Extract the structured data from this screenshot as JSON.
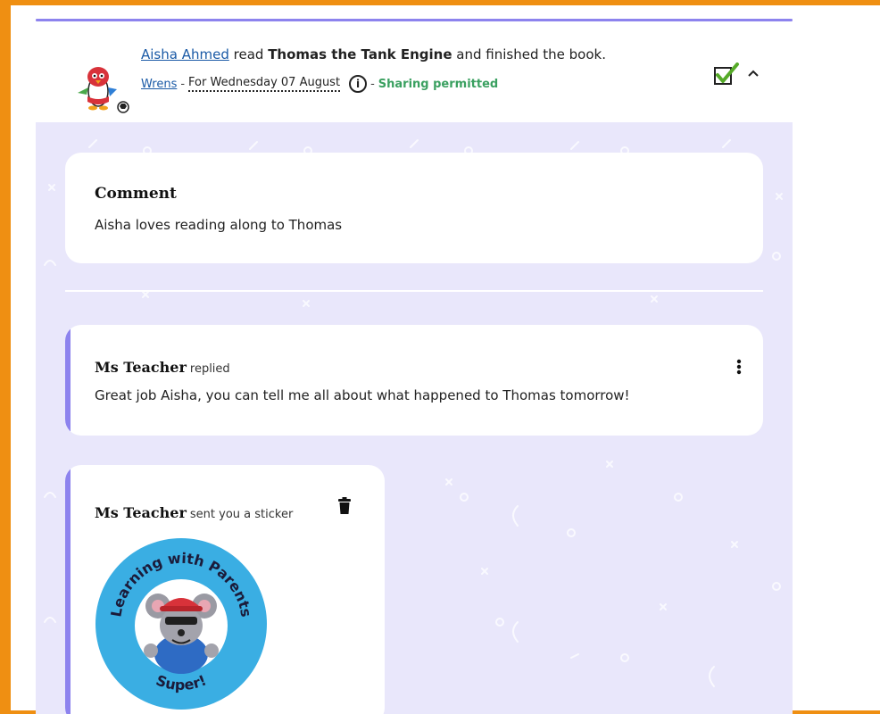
{
  "entry": {
    "reader_name": "Aisha Ahmed",
    "verb": "read",
    "book_title": "Thomas the Tank Engine",
    "suffix": "and finished the book.",
    "group": "Wrens",
    "separator": "-",
    "date": "For Wednesday 07 August",
    "separator2": "-",
    "sharing": "Sharing permitted",
    "info_icon": "i"
  },
  "comment": {
    "title": "Comment",
    "text": "Aisha loves reading along to Thomas"
  },
  "reply": {
    "author": "Ms Teacher",
    "verb": "replied",
    "text": "Great job Aisha, you can tell me all about what happened to Thomas tomorrow!"
  },
  "sticker": {
    "author": "Ms Teacher",
    "verb": "sent you a sticker",
    "ring_text": "Learning with Parents",
    "caption": "Super!"
  },
  "icons": {
    "avatar": "penguin-avatar-icon",
    "check": "checkbox-checked-icon",
    "chevron": "chevron-up-icon",
    "menu": "kebab-menu-icon",
    "delete": "trash-icon"
  },
  "colors": {
    "frame": "#ef8f12",
    "accent": "#8d83ee",
    "background": "#e9e7fb",
    "link": "#1a5aa6",
    "sharing": "#3aa060",
    "sticker_ring": "#3aaee3"
  }
}
